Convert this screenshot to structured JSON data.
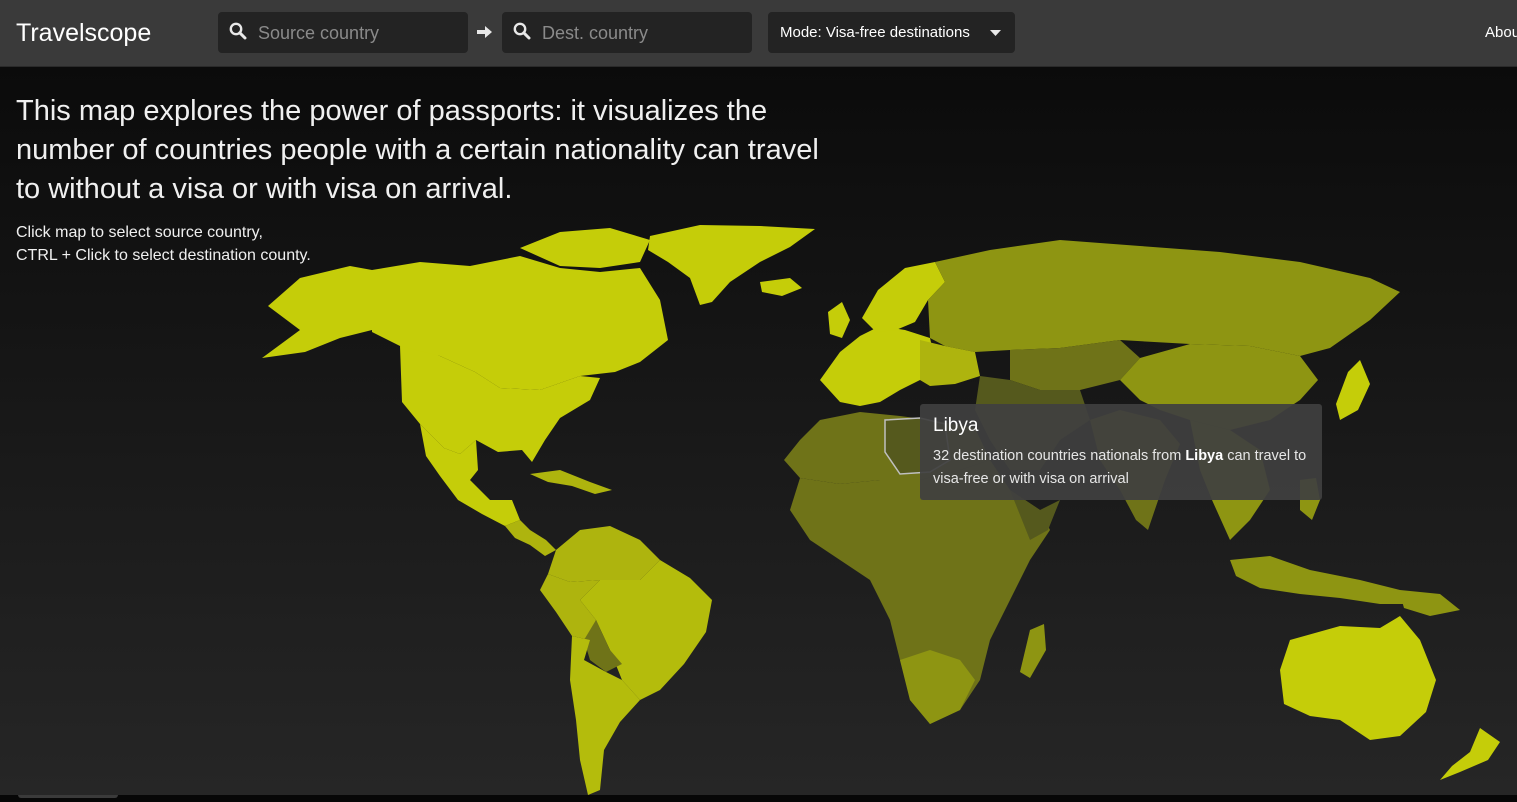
{
  "app": {
    "title": "Travelscope"
  },
  "header": {
    "source_search": {
      "placeholder": "Source country",
      "icon": "search-icon"
    },
    "arrow_icon": "arrow-right-icon",
    "dest_search": {
      "placeholder": "Dest. country",
      "icon": "search-icon"
    },
    "mode": {
      "label": "Mode: Visa-free destinations",
      "icon": "caret-down-icon"
    },
    "about": "About"
  },
  "intro": {
    "headline": "This map explores the power of passports: it visualizes the number of countries people with a certain nationality can travel to without a visa or with visa on arrival.",
    "hint_line1": "Click map to select source country,",
    "hint_line2": "CTRL + Click to select destination county."
  },
  "tooltip": {
    "country": "Libya",
    "count": "32",
    "text_prefix": "destination countries nationals from",
    "text_suffix": "can travel to visa-free or with visa on arrival"
  },
  "colors": {
    "background": "#1b1b1b",
    "navbar": "#3a3a3a",
    "input": "#232323",
    "high": "#c5cd09",
    "upper": "#aeb40e",
    "mid": "#8e9512",
    "low": "#6f7318",
    "lowest": "#55591d"
  }
}
